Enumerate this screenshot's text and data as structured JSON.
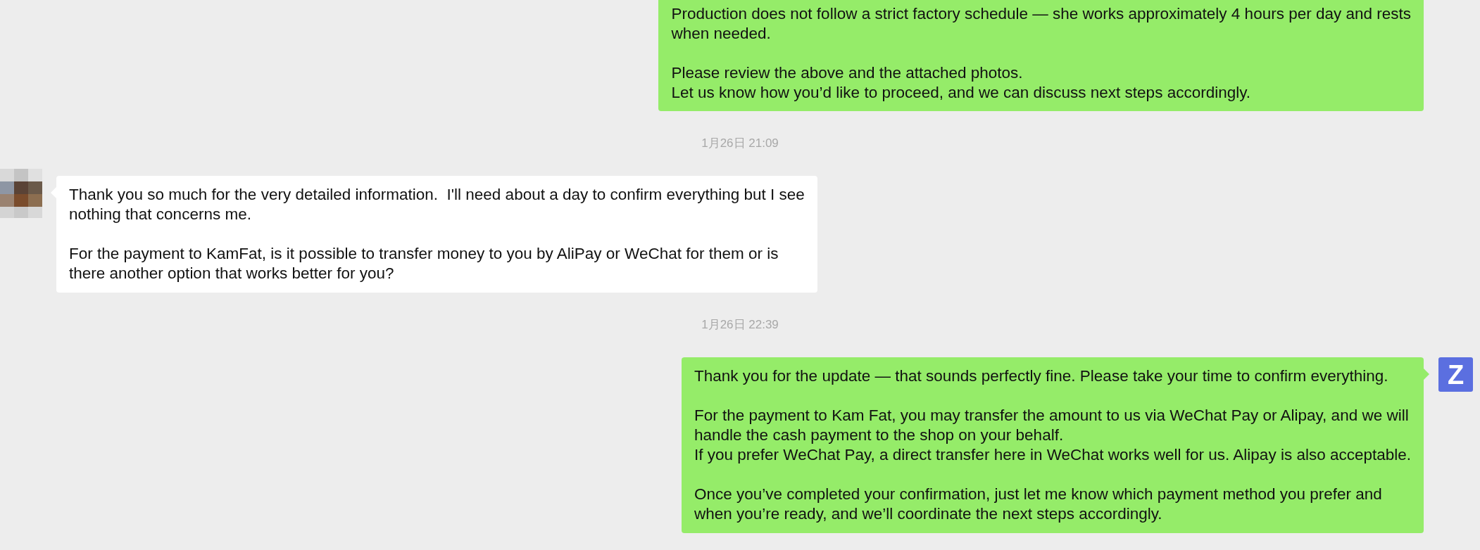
{
  "chat": [
    {
      "kind": "message",
      "outgoing": true,
      "paragraphs": [
        "Production does not follow a strict factory schedule — she works approximately 4 hours per day and rests\nwhen needed.",
        "Please review the above and the attached photos.\nLet us know how you’d like to proceed, and we can discuss next steps accordingly."
      ]
    },
    {
      "kind": "time",
      "text": "1月26日 21:09"
    },
    {
      "kind": "message",
      "outgoing": false,
      "avatar": {
        "kind": "picture"
      },
      "paragraphs": [
        "Thank you so much for the very detailed information.  I'll need about a day to confirm everything but I see\nnothing that concerns me.",
        "For the payment to KamFat, is it possible to transfer money to you by AliPay or WeChat for them or is\nthere another option that works better for you?"
      ]
    },
    {
      "kind": "time",
      "text": "1月26日 22:39"
    },
    {
      "kind": "message",
      "outgoing": true,
      "avatar": {
        "kind": "letter",
        "letter": "Z",
        "color": "#5b6fe0"
      },
      "paragraphs": [
        "Thank you for the update — that sounds perfectly fine. Please take your time to confirm everything.",
        "For the payment to Kam Fat, you may transfer the amount to us via WeChat Pay or Alipay, and we will\nhandle the cash payment to the shop on your behalf.\nIf you prefer WeChat Pay, a direct transfer here in WeChat works well for us. Alipay is also acceptable.",
        "Once you’ve completed your confirmation, just let me know which payment method you prefer and\nwhen you’re ready, and we’ll coordinate the next steps accordingly."
      ]
    }
  ]
}
